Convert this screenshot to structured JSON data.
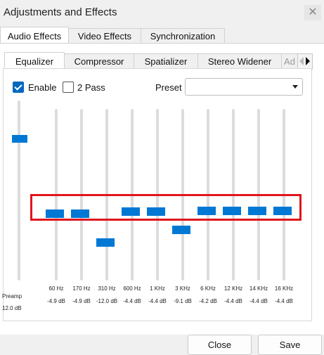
{
  "window": {
    "title": "Adjustments and Effects",
    "close_glyph": "✕"
  },
  "main_tabs": [
    "Audio Effects",
    "Video Effects",
    "Synchronization"
  ],
  "sub_tabs": [
    "Equalizer",
    "Compressor",
    "Spatializer",
    "Stereo Widener",
    "Ad"
  ],
  "equalizer": {
    "enable_label": "Enable",
    "enable_checked": true,
    "two_pass_label": "2 Pass",
    "two_pass_checked": false,
    "preset_label": "Preset",
    "preset_value": "",
    "preamp": {
      "label": "Preamp",
      "value": "12.0 dB",
      "gain_db": 12.0
    },
    "bands": [
      {
        "freq": "60 Hz",
        "value": "-4.9 dB",
        "gain_db": -4.9
      },
      {
        "freq": "170 Hz",
        "value": "-4.9 dB",
        "gain_db": -4.9
      },
      {
        "freq": "310 Hz",
        "value": "-12.0 dB",
        "gain_db": -12.0
      },
      {
        "freq": "600 Hz",
        "value": "-4.4 dB",
        "gain_db": -4.4
      },
      {
        "freq": "1 KHz",
        "value": "-4.4 dB",
        "gain_db": -4.4
      },
      {
        "freq": "3 KHz",
        "value": "-9.1 dB",
        "gain_db": -9.1
      },
      {
        "freq": "6 KHz",
        "value": "-4.2 dB",
        "gain_db": -4.2
      },
      {
        "freq": "12 KHz",
        "value": "-4.4 dB",
        "gain_db": -4.4
      },
      {
        "freq": "14 KHz",
        "value": "-4.4 dB",
        "gain_db": -4.4
      },
      {
        "freq": "16 KHz",
        "value": "-4.4 dB",
        "gain_db": -4.4
      }
    ]
  },
  "buttons": {
    "close": "Close",
    "save": "Save"
  },
  "colors": {
    "accent": "#0078d4",
    "highlight_box": "#e0161c"
  }
}
